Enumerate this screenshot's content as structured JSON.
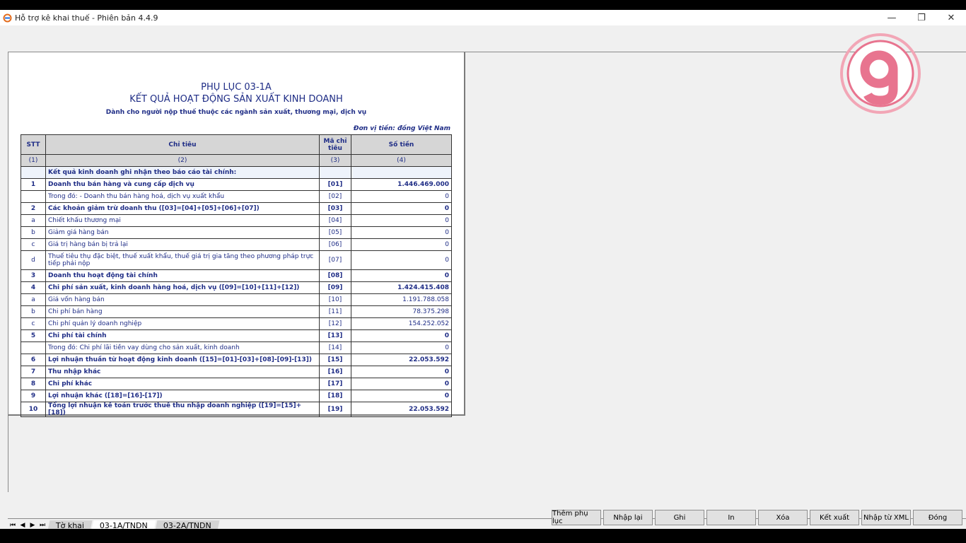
{
  "window": {
    "title": "Hỗ trợ kê khai thuế -  Phiên bản 4.4.9",
    "minimize": "—",
    "maximize": "❐",
    "close": "✕"
  },
  "report": {
    "heading1": "PHỤ LỤC 03-1A",
    "heading2": "KẾT QUẢ HOẠT ĐỘNG SẢN XUẤT KINH DOANH",
    "heading3": "Dành cho người nộp thuế thuộc các ngành sản xuất, thương mại, dịch vụ",
    "unit": "Đơn vị tiền: đồng Việt Nam",
    "columns": {
      "stt": "STT",
      "chitieu": "Chỉ tiêu",
      "ma": "Mã chỉ tiêu",
      "sotien": "Số tiền"
    },
    "col_numbers": {
      "c1": "(1)",
      "c2": "(2)",
      "c3": "(3)",
      "c4": "(4)"
    },
    "section": "Kết quả  kinh doanh ghi nhận theo báo cáo tài chính:",
    "rows": [
      {
        "stt": "1",
        "label": "Doanh thu bán hàng  và cung cấp dịch vụ",
        "code": "[01]",
        "amount": "1.446.469.000"
      },
      {
        "stt": "",
        "label": "Trong đó: - Doanh thu bán hàng hoá, dịch vụ xuất khẩu",
        "code": "[02]",
        "amount": "0"
      },
      {
        "stt": "2",
        "label": "Các khoản giảm trừ doanh thu ([03]=[04]+[05]+[06]+[07])",
        "code": "[03]",
        "amount": "0"
      },
      {
        "stt": "a",
        "label": "Chiết khấu thương mại",
        "code": "[04]",
        "amount": "0"
      },
      {
        "stt": "b",
        "label": "Giảm giá hàng bán",
        "code": "[05]",
        "amount": "0"
      },
      {
        "stt": "c",
        "label": "Giá trị hàng bán bị trả lại",
        "code": "[06]",
        "amount": "0"
      },
      {
        "stt": "d",
        "label": "Thuế tiêu thụ đặc biệt, thuế xuất khẩu, thuế giá trị gia tăng theo phương pháp trực tiếp phải nộp",
        "code": "[07]",
        "amount": "0"
      },
      {
        "stt": "3",
        "label": "Doanh thu hoạt động tài chính",
        "code": "[08]",
        "amount": "0"
      },
      {
        "stt": "4",
        "label": "Chi phí sản xuất, kinh doanh hàng hoá, dịch vụ ([09]=[10]+[11]+[12])",
        "code": "[09]",
        "amount": "1.424.415.408"
      },
      {
        "stt": "a",
        "label": "Giá vốn hàng bán",
        "code": "[10]",
        "amount": "1.191.788.058"
      },
      {
        "stt": "b",
        "label": "Chi phí bán hàng",
        "code": "[11]",
        "amount": "78.375.298"
      },
      {
        "stt": "c",
        "label": "Chi phí quản lý doanh nghiệp",
        "code": "[12]",
        "amount": "154.252.052"
      },
      {
        "stt": "5",
        "label": "Chi phí tài chính",
        "code": "[13]",
        "amount": "0"
      },
      {
        "stt": "",
        "label": "Trong đó: Chi phí lãi tiền vay dùng cho sản xuất, kinh doanh",
        "code": "[14]",
        "amount": "0"
      },
      {
        "stt": "6",
        "label": "Lợi nhuận thuần từ hoạt động kinh doanh  ([15]=[01]-[03]+[08]-[09]-[13])",
        "code": "[15]",
        "amount": "22.053.592"
      },
      {
        "stt": "7",
        "label": "Thu nhập khác",
        "code": "[16]",
        "amount": "0"
      },
      {
        "stt": "8",
        "label": "Chi phí khác",
        "code": "[17]",
        "amount": "0"
      },
      {
        "stt": "9",
        "label": "Lợi nhuận khác ([18]=[16]-[17])",
        "code": "[18]",
        "amount": "0"
      },
      {
        "stt": "10",
        "label": "Tổng lợi nhuận kế toán trước thuế thu nhập doanh nghiệp ([19]=[15]+[18])",
        "code": "[19]",
        "amount": "22.053.592"
      }
    ]
  },
  "tabs": {
    "nav_first": "⏮",
    "nav_prev": "◀",
    "nav_next": "▶",
    "nav_last": "⏭",
    "t1": "Tờ khai",
    "t2": "03-1A/TNDN",
    "t3": "03-2A/TNDN"
  },
  "buttons": {
    "them": "Thêm phụ lục",
    "nhaplai": "Nhập lại",
    "ghi": "Ghi",
    "in": "In",
    "xoa": "Xóa",
    "ketxuat": "Kết xuất",
    "nhapxml": "Nhập từ XML",
    "dong": "Đóng"
  },
  "colors": {
    "text_blue": "#1f2d86",
    "logo_pink": "#e8748f"
  }
}
